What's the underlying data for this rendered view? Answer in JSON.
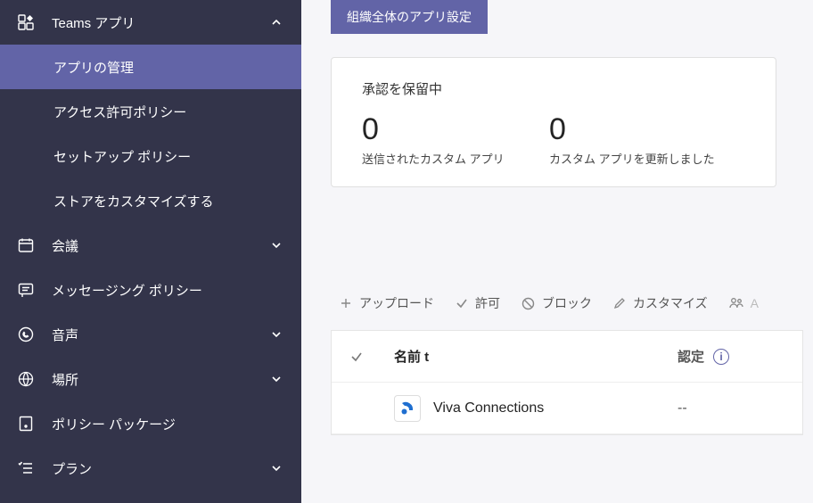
{
  "sidebar": {
    "teams_apps": {
      "label": "Teams アプリ"
    },
    "sub": {
      "manage": "アプリの管理",
      "perm": "アクセス許可ポリシー",
      "setup": "セットアップ ポリシー",
      "store": "ストアをカスタマイズする"
    },
    "meetings": "会議",
    "messaging": "メッセージング ポリシー",
    "voice": "音声",
    "locations": "場所",
    "policy_pkg": "ポリシー パッケージ",
    "planning": "プラン"
  },
  "main": {
    "org_settings_btn": "組織全体のアプリ設定",
    "card": {
      "title": "承認を保留中",
      "col1_num": "0",
      "col1_label": "送信されたカスタム アプリ",
      "col2_num": "0",
      "col2_label": "カスタム アプリを更新しました"
    },
    "toolbar": {
      "upload": "アップロード",
      "allow": "許可",
      "block": "ブロック",
      "customize": "カスタマイズ",
      "add": "A"
    },
    "table": {
      "col_name": "名前 t",
      "col_cert": "認定",
      "rows": [
        {
          "name": "Viva Connections",
          "cert": "--"
        }
      ]
    }
  }
}
